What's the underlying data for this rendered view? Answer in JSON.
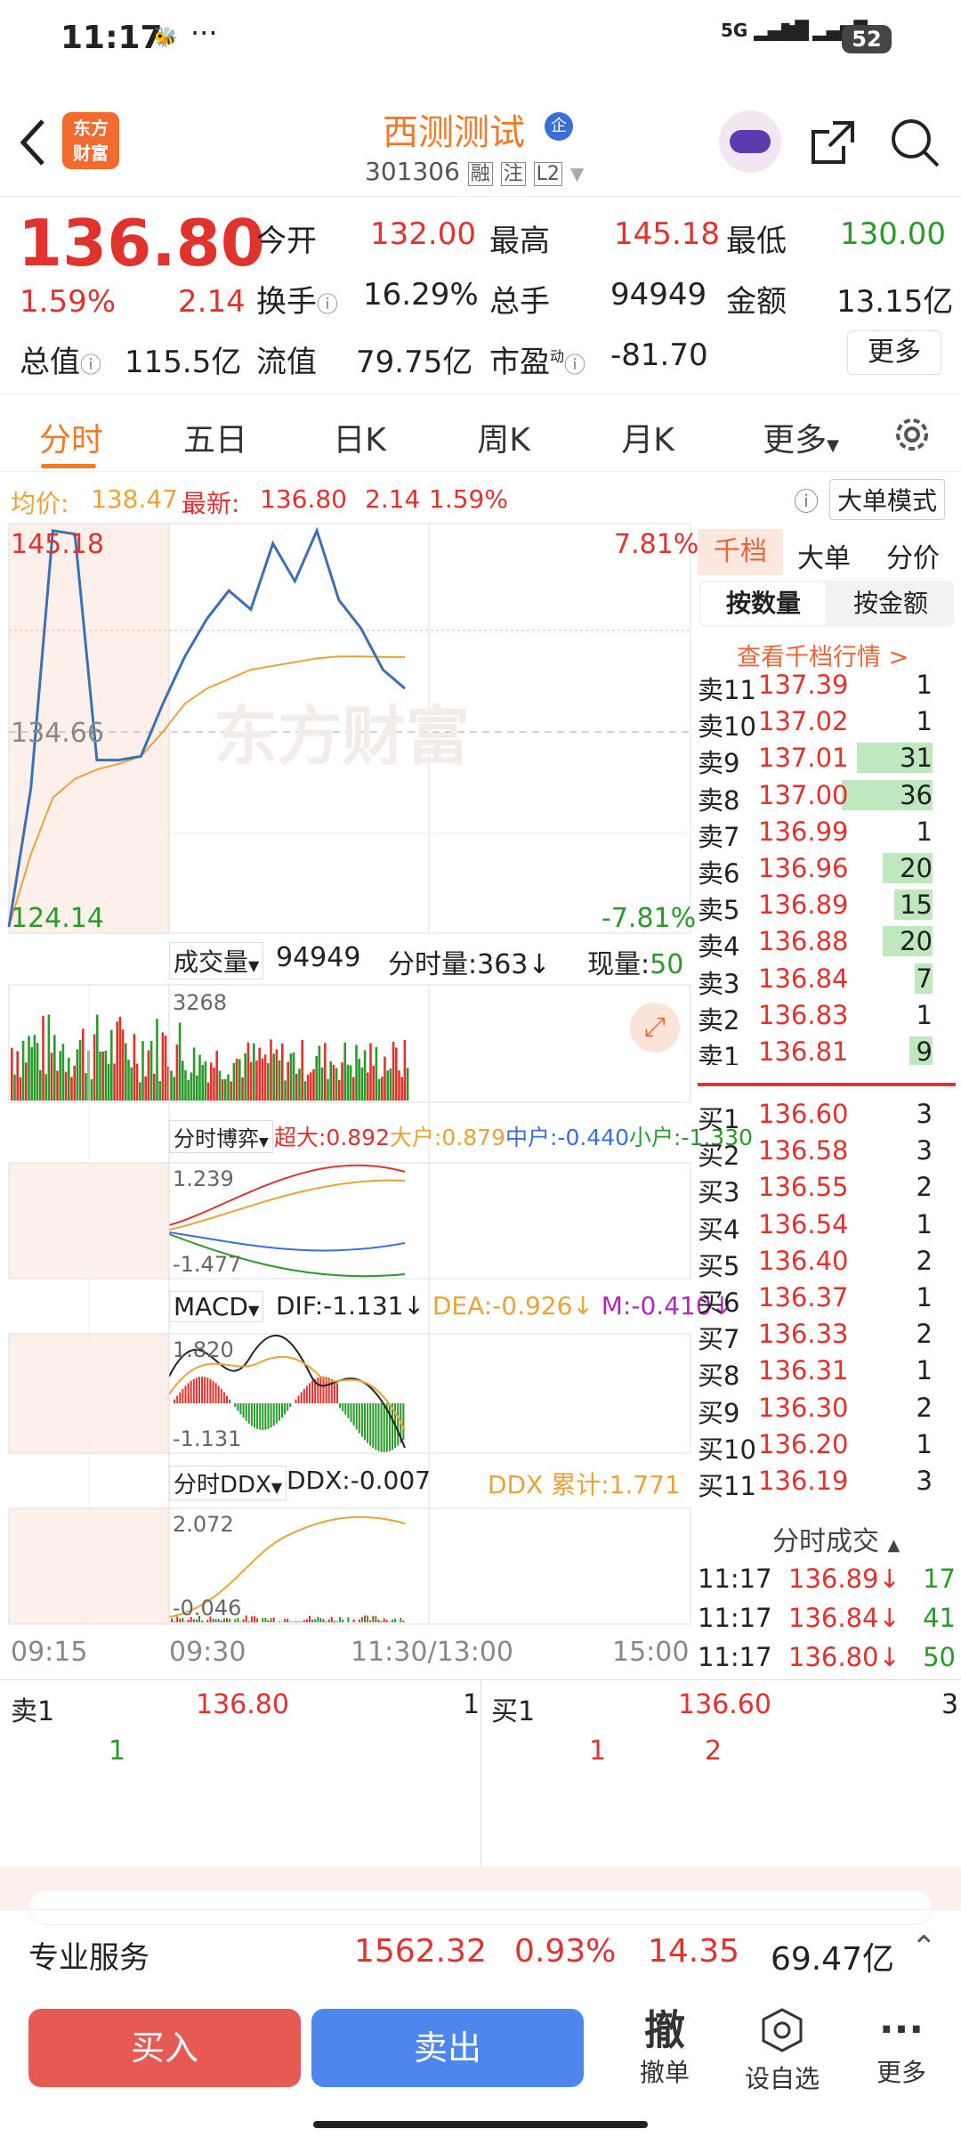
{
  "status_bar": {
    "time": "11:17",
    "dots": "···",
    "signal1": "5G",
    "signal2": "5G",
    "battery": "52"
  },
  "header": {
    "back_label": "<",
    "logo_line1": "东方",
    "logo_line2": "财富",
    "stock_name": "西测测试",
    "badge": "企",
    "stock_code": "301306",
    "tags": [
      "融",
      "注",
      "L2"
    ]
  },
  "quote": {
    "price": "136.80",
    "change_pct": "1.59%",
    "change": "2.14",
    "open_label": "今开",
    "open": "132.00",
    "high_label": "最高",
    "high": "145.18",
    "low_label": "最低",
    "low": "130.00",
    "turnover_label": "换手",
    "turnover": "16.29%",
    "volume_label": "总手",
    "volume": "94949",
    "amount_label": "金额",
    "amount": "13.15亿",
    "mktcap_label": "总值",
    "mktcap": "115.5亿",
    "float_label": "流值",
    "float": "79.75亿",
    "pe_label": "市盈",
    "pe_sup": "动",
    "pe": "-81.70",
    "more_label": "更多"
  },
  "tabs": [
    "分时",
    "五日",
    "日K",
    "周K",
    "月K",
    "更多"
  ],
  "avg_line": {
    "avg_label": "均价:",
    "avg": "138.47",
    "latest_label": "最新:",
    "latest": "136.80",
    "change": "2.14",
    "pct": "1.59%",
    "mode_label": "大单模式"
  },
  "chart": {
    "price_high": "145.18",
    "price_mid": "134.66",
    "price_low": "124.14",
    "pct_high": "7.81%",
    "pct_low": "-7.81%",
    "watermark": "东方财富",
    "vol_selector": "成交量",
    "vol_value": "94949",
    "tick_vol_label": "分时量:363↓",
    "now_vol_label": "现量:",
    "now_vol": "50",
    "vol_axis": "3268",
    "game_selector": "分时博弈",
    "game_super": "超大:0.892",
    "game_big": "大户:0.879",
    "game_mid": "中户:-0.440",
    "game_small": "小户:-1.330",
    "game_top": "1.239",
    "game_bottom": "-1.477",
    "macd_selector": "MACD",
    "dif": "DIF:-1.131↓",
    "dea": "DEA:-0.926↓",
    "m": "M:-0.410↓",
    "macd_top": "1.820",
    "macd_bottom": "-1.131",
    "ddx_selector": "分时DDX",
    "ddx": "DDX:-0.007",
    "ddx_sum": "DDX 累计:1.771",
    "ddx_top": "2.072",
    "ddx_bottom": "-0.046",
    "times": [
      "09:15",
      "09:30",
      "11:30/13:00",
      "15:00"
    ]
  },
  "chart_data": {
    "type": "line",
    "title": "",
    "series": [
      {
        "name": "最新",
        "values": [
          124.14,
          131.5,
          145.18,
          145.0,
          133.0,
          133.0,
          133.2,
          136.0,
          138.5,
          140.5,
          142.0,
          141.0,
          144.5,
          142.5,
          145.18,
          141.5,
          140.0,
          137.8,
          136.8
        ]
      },
      {
        "name": "均价",
        "values": [
          124.14,
          128.0,
          131.0,
          132.0,
          132.5,
          132.8,
          133.2,
          134.5,
          136.0,
          136.8,
          137.3,
          137.8,
          138.0,
          138.2,
          138.4,
          138.5,
          138.5,
          138.47,
          138.47
        ]
      }
    ],
    "ylim": [
      124.14,
      145.18
    ],
    "x_ticks": [
      "09:15",
      "09:30",
      "11:30/13:00",
      "15:00"
    ],
    "ylabel": "",
    "xlabel": ""
  },
  "book": {
    "tabs": [
      "千档",
      "大单",
      "分价"
    ],
    "subtabs": [
      "按数量",
      "按金额"
    ],
    "view_more": "查看千档行情 >",
    "asks": [
      {
        "label": "卖11",
        "price": "137.39",
        "qty": "1"
      },
      {
        "label": "卖10",
        "price": "137.02",
        "qty": "1"
      },
      {
        "label": "卖9",
        "price": "137.01",
        "qty": "31",
        "fill": 0.5
      },
      {
        "label": "卖8",
        "price": "137.00",
        "qty": "36",
        "fill": 0.6
      },
      {
        "label": "卖7",
        "price": "136.99",
        "qty": "1"
      },
      {
        "label": "卖6",
        "price": "136.96",
        "qty": "20",
        "fill": 0.33
      },
      {
        "label": "卖5",
        "price": "136.89",
        "qty": "15",
        "fill": 0.25
      },
      {
        "label": "卖4",
        "price": "136.88",
        "qty": "20",
        "fill": 0.33
      },
      {
        "label": "卖3",
        "price": "136.84",
        "qty": "7",
        "fill": 0.12
      },
      {
        "label": "卖2",
        "price": "136.83",
        "qty": "1"
      },
      {
        "label": "卖1",
        "price": "136.81",
        "qty": "9",
        "fill": 0.15
      }
    ],
    "bids": [
      {
        "label": "买1",
        "price": "136.60",
        "qty": "3"
      },
      {
        "label": "买2",
        "price": "136.58",
        "qty": "3"
      },
      {
        "label": "买3",
        "price": "136.55",
        "qty": "2"
      },
      {
        "label": "买4",
        "price": "136.54",
        "qty": "1"
      },
      {
        "label": "买5",
        "price": "136.40",
        "qty": "2"
      },
      {
        "label": "买6",
        "price": "136.37",
        "qty": "1"
      },
      {
        "label": "买7",
        "price": "136.33",
        "qty": "2"
      },
      {
        "label": "买8",
        "price": "136.31",
        "qty": "1"
      },
      {
        "label": "买9",
        "price": "136.30",
        "qty": "2"
      },
      {
        "label": "买10",
        "price": "136.20",
        "qty": "1"
      },
      {
        "label": "买11",
        "price": "136.19",
        "qty": "3"
      }
    ],
    "ticks_title": "分时成交",
    "ticks": [
      {
        "time": "11:17",
        "price": "136.89↓",
        "qty": "17"
      },
      {
        "time": "11:17",
        "price": "136.84↓",
        "qty": "41"
      },
      {
        "time": "11:17",
        "price": "136.80↓",
        "qty": "50"
      }
    ]
  },
  "queue": {
    "sell_label": "卖1",
    "sell_price": "136.80",
    "sell_qty": "1",
    "sell_items": [
      "1"
    ],
    "buy_label": "买1",
    "buy_price": "136.60",
    "buy_qty": "3",
    "buy_items": [
      "1",
      "2"
    ]
  },
  "index_bar": {
    "label": "专业服务",
    "value": "1562.32",
    "pct": "0.93%",
    "change": "14.35",
    "amount": "69.47亿"
  },
  "actions": {
    "buy": "买入",
    "sell": "卖出",
    "cancel_glyph": "撤",
    "cancel": "撤单",
    "watch": "设自选",
    "more": "更多"
  }
}
